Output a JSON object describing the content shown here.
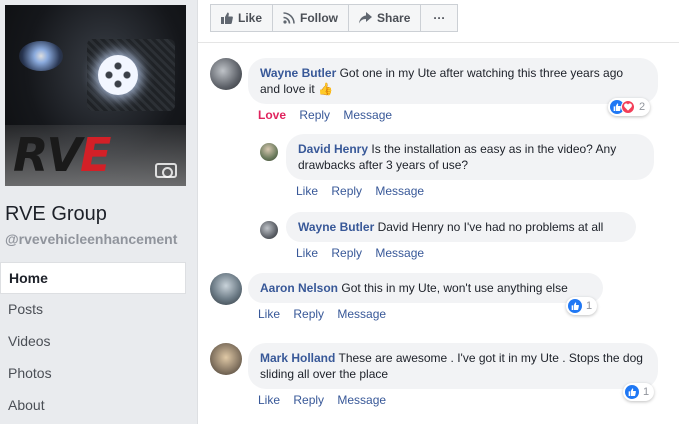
{
  "page": {
    "name": "RVE Group",
    "handle": "@rvevehicleenhancement",
    "cover_logo_r": "RV",
    "cover_logo_e": "E"
  },
  "nav": {
    "items": [
      {
        "label": "Home",
        "active": true
      },
      {
        "label": "Posts",
        "active": false
      },
      {
        "label": "Videos",
        "active": false
      },
      {
        "label": "Photos",
        "active": false
      },
      {
        "label": "About",
        "active": false
      }
    ]
  },
  "actions": {
    "like": "Like",
    "follow": "Follow",
    "share": "Share",
    "more": "···"
  },
  "comments": [
    {
      "author": "Wayne Butler",
      "text": "Got one in my Ute after watching this three years ago and love it 👍",
      "links": [
        "Love",
        "Reply",
        "Message"
      ],
      "reaction_count": "2",
      "replies": [
        {
          "author": "David Henry",
          "text": "Is the installation as easy as in the video? Any drawbacks after 3 years of use?",
          "links": [
            "Like",
            "Reply",
            "Message"
          ]
        },
        {
          "author": "Wayne Butler",
          "text": "David Henry no I've had no problems at all",
          "links": [
            "Like",
            "Reply",
            "Message"
          ]
        }
      ]
    },
    {
      "author": "Aaron Nelson",
      "text": "Got this in my Ute, won't use anything else",
      "links": [
        "Like",
        "Reply",
        "Message"
      ],
      "reaction_count": "1"
    },
    {
      "author": "Mark Holland",
      "text": "These are awesome . I've got it in my Ute . Stops the dog sliding all over the place",
      "links": [
        "Like",
        "Reply",
        "Message"
      ],
      "reaction_count": "1"
    }
  ],
  "colors": {
    "link": "#385898",
    "love": "#e0245e",
    "like_icon": "#2078f4",
    "heart_icon": "#f33e58",
    "bubble": "#f2f3f5"
  }
}
